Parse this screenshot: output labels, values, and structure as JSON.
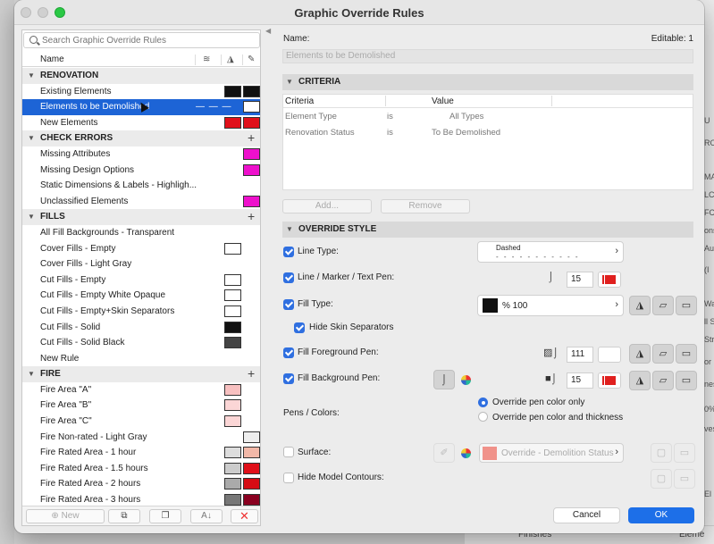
{
  "window": {
    "title": "Graphic Override Rules"
  },
  "search": {
    "placeholder": "Search Graphic Override Rules"
  },
  "list_header": {
    "name": "Name"
  },
  "groups": [
    {
      "label": "RENOVATION",
      "items": [
        {
          "label": "Existing Elements",
          "swatch_a": "#111111",
          "swatch_b": "#111111"
        },
        {
          "label": "Elements to be Demolished",
          "selected": true,
          "line": "— — —",
          "swatch_b": "#ffffff"
        },
        {
          "label": "New Elements",
          "swatch_a": "#e0101a",
          "swatch_b": "#e0101a"
        }
      ]
    },
    {
      "label": "CHECK ERRORS",
      "items": [
        {
          "label": "Missing Attributes",
          "swatch_b": "#ee10cc"
        },
        {
          "label": "Missing Design Options",
          "swatch_b": "#ee10cc"
        },
        {
          "label": "Static Dimensions & Labels - Highligh..."
        },
        {
          "label": "Unclassified Elements",
          "swatch_b": "#ee10cc"
        }
      ]
    },
    {
      "label": "FILLS",
      "items": [
        {
          "label": "All Fill Backgrounds - Transparent"
        },
        {
          "label": "Cover Fills - Empty",
          "swatch_a": "#ffffff"
        },
        {
          "label": "Cover Fills - Light Gray"
        },
        {
          "label": "Cut Fills - Empty",
          "swatch_a": "#ffffff"
        },
        {
          "label": "Cut Fills - Empty White Opaque",
          "swatch_a": "#ffffff"
        },
        {
          "label": "Cut Fills - Empty+Skin Separators",
          "swatch_a": "#ffffff"
        },
        {
          "label": "Cut Fills - Solid",
          "swatch_a": "#111111"
        },
        {
          "label": "Cut Fills - Solid Black",
          "swatch_a": "#444444"
        },
        {
          "label": "New Rule"
        }
      ]
    },
    {
      "label": "FIRE",
      "items": [
        {
          "label": "Fire Area \"A\"",
          "swatch_a": "#f7c0c0"
        },
        {
          "label": "Fire Area \"B\"",
          "swatch_a": "#fbd6d6"
        },
        {
          "label": "Fire Area \"C\"",
          "swatch_a": "#fbd6d6"
        },
        {
          "label": "Fire Non-rated - Light Gray",
          "swatch_b": "#eeeeee"
        },
        {
          "label": "Fire Rated Area - 1 hour",
          "swatch_a": "#dddddd",
          "swatch_b": "#f2b8a8"
        },
        {
          "label": "Fire Rated Area - 1.5 hours",
          "swatch_a": "#cccccc",
          "swatch_b": "#e0101a"
        },
        {
          "label": "Fire Rated Area - 2 hours",
          "swatch_a": "#aaaaaa",
          "swatch_b": "#d60c14"
        },
        {
          "label": "Fire Rated Area - 3 hours",
          "swatch_a": "#777777",
          "swatch_b": "#8a0020"
        }
      ]
    }
  ],
  "left_footer": {
    "new_label": "New"
  },
  "right": {
    "name_label": "Name:",
    "editable": "Editable: 1",
    "name_value": "Elements to be Demolished",
    "criteria_title": "CRITERIA",
    "criteria_headers": [
      "Criteria",
      "Value"
    ],
    "criteria_rows": [
      {
        "criterion": "Element Type",
        "op": "is",
        "value": "All Types"
      },
      {
        "criterion": "Renovation Status",
        "op": "is",
        "value": "To Be Demolished"
      }
    ],
    "add_label": "Add...",
    "remove_label": "Remove",
    "override_title": "OVERRIDE STYLE",
    "line_type_label": "Line Type:",
    "line_type_value": "Dashed",
    "pen_label": "Line / Marker / Text Pen:",
    "pen_value": "15",
    "fill_type_label": "Fill Type:",
    "fill_type_value": "% 100",
    "hide_skin_label": "Hide Skin Separators",
    "fill_fg_label": "Fill Foreground Pen:",
    "fill_fg_value": "111",
    "fill_bg_label": "Fill Background Pen:",
    "fill_bg_value": "15",
    "pens_colors_label": "Pens / Colors:",
    "radio_1": "Override pen color only",
    "radio_2": "Override pen color and thickness",
    "surface_label": "Surface:",
    "surface_value": "Override - Demolition Status",
    "hide_contours_label": "Hide Model Contours:"
  },
  "buttons": {
    "cancel": "Cancel",
    "ok": "OK"
  },
  "background": {
    "right_fragments": [
      "U",
      "RO",
      "MA",
      "LC",
      "FC",
      "ons",
      "Au",
      "(I",
      "Wa",
      "ll S",
      "Str",
      "or",
      "nes",
      "0%",
      "ves",
      "El"
    ],
    "bottom_a": "Finishes",
    "bottom_b": "Eleme"
  },
  "colors": {
    "accent": "#1d64d6",
    "ok": "#1d6fe8",
    "pen_red": "#e0201e"
  }
}
